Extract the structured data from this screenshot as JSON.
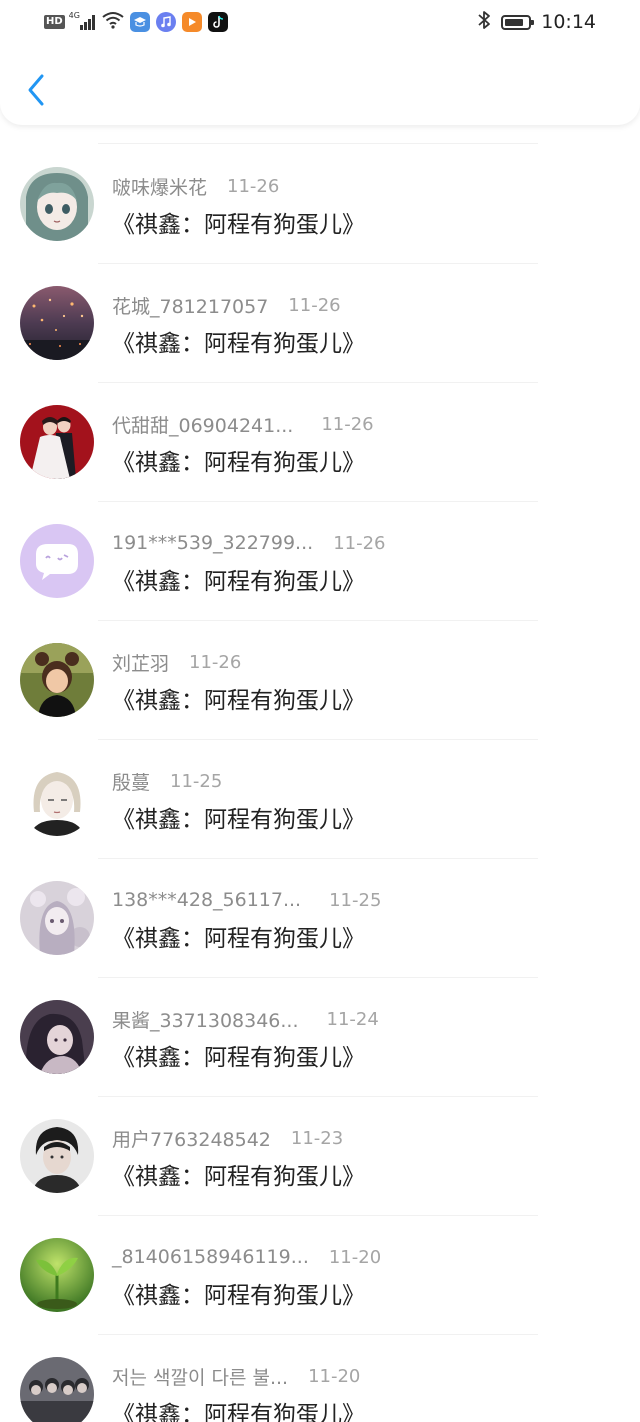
{
  "status_bar": {
    "hd": "HD",
    "net_type": "4G",
    "time": "10:14",
    "battery_level": 0.8,
    "icons": [
      "signal-icon",
      "wifi-icon",
      "education-app-icon",
      "music-app-icon",
      "video-app-icon",
      "tiktok-icon",
      "bluetooth-icon",
      "battery-icon"
    ]
  },
  "nav": {
    "back_icon": "chevron-left-icon",
    "accent": "#2196f3"
  },
  "colors": {
    "username": "#8c8c8c",
    "date": "#a5a5a5",
    "content": "#222222",
    "divider": "#f1f1f1"
  },
  "messages": [
    {
      "username": "啵味爆米花",
      "date": "11-26",
      "content": "《祺鑫：阿程有狗蛋儿》",
      "avatar": "anime-girl-avatar"
    },
    {
      "username": "花城_781217057",
      "date": "11-26",
      "content": "《祺鑫：阿程有狗蛋儿》",
      "avatar": "lanterns-night-avatar"
    },
    {
      "username": "代甜甜_06904241...",
      "date": "11-26",
      "content": "《祺鑫：阿程有狗蛋儿》",
      "avatar": "wedding-couple-avatar"
    },
    {
      "username": "191***539_322799...",
      "date": "11-26",
      "content": "《祺鑫：阿程有狗蛋儿》",
      "avatar": "default-chat-avatar"
    },
    {
      "username": "刘芷羽",
      "date": "11-26",
      "content": "《祺鑫：阿程有狗蛋儿》",
      "avatar": "child-photo-avatar"
    },
    {
      "username": "殷蔓",
      "date": "11-25",
      "content": "《祺鑫：阿程有狗蛋儿》",
      "avatar": "anime-boy-avatar"
    },
    {
      "username": "138***428_56117...",
      "date": "11-25",
      "content": "《祺鑫：阿程有狗蛋儿》",
      "avatar": "lace-doll-avatar"
    },
    {
      "username": "果酱_3371308346...",
      "date": "11-24",
      "content": "《祺鑫：阿程有狗蛋儿》",
      "avatar": "dark-girl-avatar"
    },
    {
      "username": "用户7763248542",
      "date": "11-23",
      "content": "《祺鑫：阿程有狗蛋儿》",
      "avatar": "portrait-boy-avatar"
    },
    {
      "username": "_81406158946119...",
      "date": "11-20",
      "content": "《祺鑫：阿程有狗蛋儿》",
      "avatar": "sprout-avatar"
    },
    {
      "username": "저는 색깔이 다른 불...",
      "date": "11-20",
      "content": "《祺鑫：阿程有狗蛋儿》",
      "avatar": "group-photo-avatar"
    }
  ]
}
